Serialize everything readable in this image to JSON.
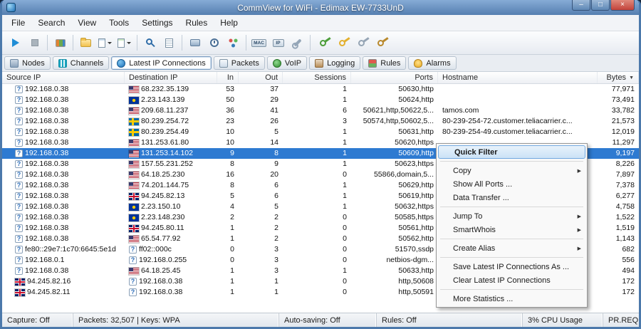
{
  "window": {
    "title": "CommView for WiFi - Edimax EW-7733UnD",
    "controls": [
      {
        "name": "minimize-button",
        "glyph": "–"
      },
      {
        "name": "maximize-button",
        "glyph": "□"
      },
      {
        "name": "close-button",
        "glyph": "×"
      }
    ]
  },
  "menu": [
    "File",
    "Search",
    "View",
    "Tools",
    "Settings",
    "Rules",
    "Help"
  ],
  "toolbar": [
    {
      "name": "start-capture-button",
      "icon": "play"
    },
    {
      "name": "stop-capture-button",
      "icon": "stop"
    },
    {
      "sep": true
    },
    {
      "name": "node-scanner-button",
      "icon": "book"
    },
    {
      "sep": true
    },
    {
      "name": "open-logs-button",
      "icon": "folder"
    },
    {
      "name": "save-button",
      "icon": "page",
      "caret": true
    },
    {
      "name": "export-button",
      "icon": "page2",
      "caret": true
    },
    {
      "sep": true
    },
    {
      "name": "find-button",
      "icon": "search"
    },
    {
      "name": "log-viewer-button",
      "icon": "log"
    },
    {
      "sep": true
    },
    {
      "name": "node-reassociation-button",
      "icon": "nodes"
    },
    {
      "name": "scheduler-button",
      "icon": "clock"
    },
    {
      "name": "packet-generator-button",
      "icon": "graph"
    },
    {
      "sep": true
    },
    {
      "name": "mac-aliases-button",
      "icon": "chip",
      "label": "MAC"
    },
    {
      "name": "ip-aliases-button",
      "icon": "chip",
      "label": "IP"
    },
    {
      "name": "options-button",
      "icon": "wrench"
    },
    {
      "sep": true
    },
    {
      "name": "wep-wpa-keys-button-1",
      "icon": "key-green"
    },
    {
      "name": "wep-wpa-keys-button-2",
      "icon": "key-yellow"
    },
    {
      "name": "wep-wpa-keys-button-3",
      "icon": "key-grey"
    },
    {
      "name": "wep-wpa-keys-button-4",
      "icon": "key-gold"
    }
  ],
  "tabs": [
    {
      "label": "Nodes",
      "icon": "nodes-tab"
    },
    {
      "label": "Channels",
      "icon": "channels-tab"
    },
    {
      "label": "Latest IP Connections",
      "icon": "ip-connections-tab",
      "active": true
    },
    {
      "label": "Packets",
      "icon": "packets-tab"
    },
    {
      "label": "VoIP",
      "icon": "voip-tab"
    },
    {
      "label": "Logging",
      "icon": "logging-tab"
    },
    {
      "label": "Rules",
      "icon": "rules-tab"
    },
    {
      "label": "Alarms",
      "icon": "alarms-tab"
    }
  ],
  "table": {
    "columns": [
      {
        "label": "Source IP",
        "align": "left"
      },
      {
        "label": "Destination IP",
        "align": "left"
      },
      {
        "label": "In",
        "align": "right"
      },
      {
        "label": "Out",
        "align": "right"
      },
      {
        "label": "Sessions",
        "align": "right"
      },
      {
        "label": "Ports",
        "align": "right"
      },
      {
        "label": "Hostname",
        "align": "left"
      },
      {
        "label": "Bytes",
        "align": "right",
        "sort_indicator": "▼"
      }
    ],
    "rows": [
      {
        "source": "192.168.0.38",
        "source_flag": "q",
        "dest": "68.232.35.139",
        "dest_flag": "us",
        "in": "53",
        "out": "37",
        "sessions": "1",
        "ports": "50630,http",
        "hostname": "",
        "bytes": "77,971"
      },
      {
        "source": "192.168.0.38",
        "source_flag": "q",
        "dest": "2.23.143.139",
        "dest_flag": "eu",
        "in": "50",
        "out": "29",
        "sessions": "1",
        "ports": "50624,http",
        "hostname": "",
        "bytes": "73,491"
      },
      {
        "source": "192.168.0.38",
        "source_flag": "q",
        "dest": "209.68.11.237",
        "dest_flag": "us",
        "in": "36",
        "out": "41",
        "sessions": "6",
        "ports": "50621,http,50622,5...",
        "hostname": "tamos.com",
        "bytes": "33,782"
      },
      {
        "source": "192.168.0.38",
        "source_flag": "q",
        "dest": "80.239.254.72",
        "dest_flag": "se",
        "in": "23",
        "out": "26",
        "sessions": "3",
        "ports": "50574,http,50602,5...",
        "hostname": "80-239-254-72.customer.teliacarrier.c...",
        "bytes": "21,573"
      },
      {
        "source": "192.168.0.38",
        "source_flag": "q",
        "dest": "80.239.254.49",
        "dest_flag": "se",
        "in": "10",
        "out": "5",
        "sessions": "1",
        "ports": "50631,http",
        "hostname": "80-239-254-49.customer.teliacarrier.c...",
        "bytes": "12,019"
      },
      {
        "source": "192.168.0.38",
        "source_flag": "q",
        "dest": "131.253.61.80",
        "dest_flag": "us",
        "in": "10",
        "out": "14",
        "sessions": "1",
        "ports": "50620,https",
        "hostname": "",
        "bytes": "11,297"
      },
      {
        "source": "192.168.0.38",
        "source_flag": "q",
        "dest": "131.253.14.102",
        "dest_flag": "us",
        "in": "9",
        "out": "8",
        "sessions": "1",
        "ports": "50609,http",
        "hostname": "",
        "bytes": "9,197",
        "selected": true
      },
      {
        "source": "192.168.0.38",
        "source_flag": "q",
        "dest": "157.55.231.252",
        "dest_flag": "us",
        "in": "8",
        "out": "9",
        "sessions": "1",
        "ports": "50623,https",
        "hostname": "",
        "bytes": "8,226"
      },
      {
        "source": "192.168.0.38",
        "source_flag": "q",
        "dest": "64.18.25.230",
        "dest_flag": "us",
        "in": "16",
        "out": "20",
        "sessions": "0",
        "ports": "55866,domain,5...",
        "hostname": "",
        "bytes": "7,897"
      },
      {
        "source": "192.168.0.38",
        "source_flag": "q",
        "dest": "74.201.144.75",
        "dest_flag": "us",
        "in": "8",
        "out": "6",
        "sessions": "1",
        "ports": "50629,http",
        "hostname": "",
        "bytes": "7,378"
      },
      {
        "source": "192.168.0.38",
        "source_flag": "q",
        "dest": "94.245.82.13",
        "dest_flag": "uk",
        "in": "5",
        "out": "6",
        "sessions": "1",
        "ports": "50619,http",
        "hostname": "",
        "bytes": "6,277"
      },
      {
        "source": "192.168.0.38",
        "source_flag": "q",
        "dest": "2.23.150.10",
        "dest_flag": "eu",
        "in": "4",
        "out": "5",
        "sessions": "1",
        "ports": "50632,https",
        "hostname": "",
        "bytes": "4,758"
      },
      {
        "source": "192.168.0.38",
        "source_flag": "q",
        "dest": "2.23.148.230",
        "dest_flag": "eu",
        "in": "2",
        "out": "2",
        "sessions": "0",
        "ports": "50585,https",
        "hostname": "",
        "bytes": "1,522"
      },
      {
        "source": "192.168.0.38",
        "source_flag": "q",
        "dest": "94.245.80.11",
        "dest_flag": "uk",
        "in": "1",
        "out": "2",
        "sessions": "0",
        "ports": "50561,http",
        "hostname": "",
        "bytes": "1,519"
      },
      {
        "source": "192.168.0.38",
        "source_flag": "q",
        "dest": "65.54.77.92",
        "dest_flag": "us",
        "in": "1",
        "out": "2",
        "sessions": "0",
        "ports": "50562,http",
        "hostname": "",
        "bytes": "1,143"
      },
      {
        "source": "fe80::29e7:1c70:6645:5e1d",
        "source_flag": "q",
        "dest": "ff02::000c",
        "dest_flag": "q",
        "in": "0",
        "out": "3",
        "sessions": "0",
        "ports": "51570,ssdp",
        "hostname": "",
        "bytes": "682"
      },
      {
        "source": "192.168.0.1",
        "source_flag": "q",
        "dest": "192.168.0.255",
        "dest_flag": "q",
        "in": "0",
        "out": "3",
        "sessions": "0",
        "ports": "netbios-dgm...",
        "hostname": "",
        "bytes": "556"
      },
      {
        "source": "192.168.0.38",
        "source_flag": "q",
        "dest": "64.18.25.45",
        "dest_flag": "us",
        "in": "1",
        "out": "3",
        "sessions": "1",
        "ports": "50633,http",
        "hostname": "",
        "bytes": "494"
      },
      {
        "source": "94.245.82.16",
        "source_flag": "uk",
        "dest": "192.168.0.38",
        "dest_flag": "q",
        "in": "1",
        "out": "1",
        "sessions": "0",
        "ports": "http,50608",
        "hostname": "",
        "bytes": "172"
      },
      {
        "source": "94.245.82.11",
        "source_flag": "uk",
        "dest": "192.168.0.38",
        "dest_flag": "q",
        "in": "1",
        "out": "1",
        "sessions": "0",
        "ports": "http,50591",
        "hostname": "",
        "bytes": "172"
      }
    ]
  },
  "context_menu": {
    "items": [
      {
        "label": "Quick Filter",
        "bold": true,
        "highlighted": true
      },
      {
        "separator": true
      },
      {
        "label": "Copy",
        "submenu": true
      },
      {
        "label": "Show All Ports ..."
      },
      {
        "label": "Data Transfer ..."
      },
      {
        "separator": true
      },
      {
        "label": "Jump To",
        "submenu": true
      },
      {
        "label": "SmartWhois",
        "submenu": true
      },
      {
        "separator": true
      },
      {
        "label": "Create Alias",
        "submenu": true
      },
      {
        "separator": true
      },
      {
        "label": "Save Latest IP Connections As ..."
      },
      {
        "label": "Clear Latest IP Connections"
      },
      {
        "separator": true
      },
      {
        "label": "More Statistics ..."
      }
    ]
  },
  "status_bar": [
    "Capture: Off",
    "Packets: 32,507 | Keys: WPA",
    "Auto-saving: Off",
    "Rules: Off",
    "3% CPU Usage",
    "PR.REQ"
  ]
}
